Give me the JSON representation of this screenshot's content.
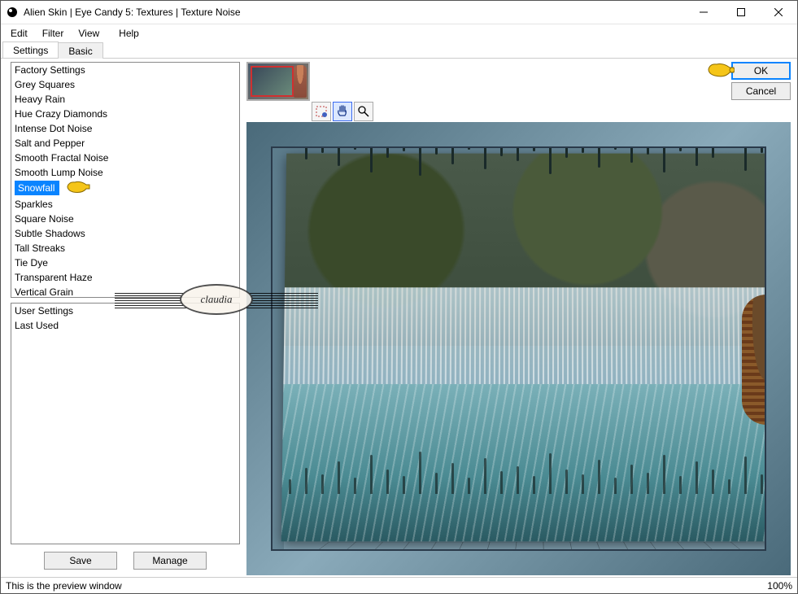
{
  "window": {
    "title": "Alien Skin | Eye Candy 5: Textures | Texture Noise"
  },
  "menu": {
    "edit": "Edit",
    "filter": "Filter",
    "view": "View",
    "help": "Help"
  },
  "tabs": {
    "settings": "Settings",
    "basic": "Basic"
  },
  "factory_list": [
    "Factory Settings",
    "Grey Squares",
    "Heavy Rain",
    "Hue Crazy Diamonds",
    "Intense Dot Noise",
    "Salt and Pepper",
    "Smooth Fractal Noise",
    "Smooth Lump Noise",
    "Snowfall",
    "Sparkles",
    "Square Noise",
    "Subtle Shadows",
    "Tall Streaks",
    "Tie Dye",
    "Transparent Haze",
    "Vertical Grain"
  ],
  "factory_selected_index": 8,
  "user_list": [
    "User Settings",
    "Last Used"
  ],
  "buttons": {
    "save": "Save",
    "manage": "Manage",
    "ok": "OK",
    "cancel": "Cancel"
  },
  "status": {
    "text": "This is the preview window",
    "zoom": "100%"
  },
  "watermark": "claudia"
}
